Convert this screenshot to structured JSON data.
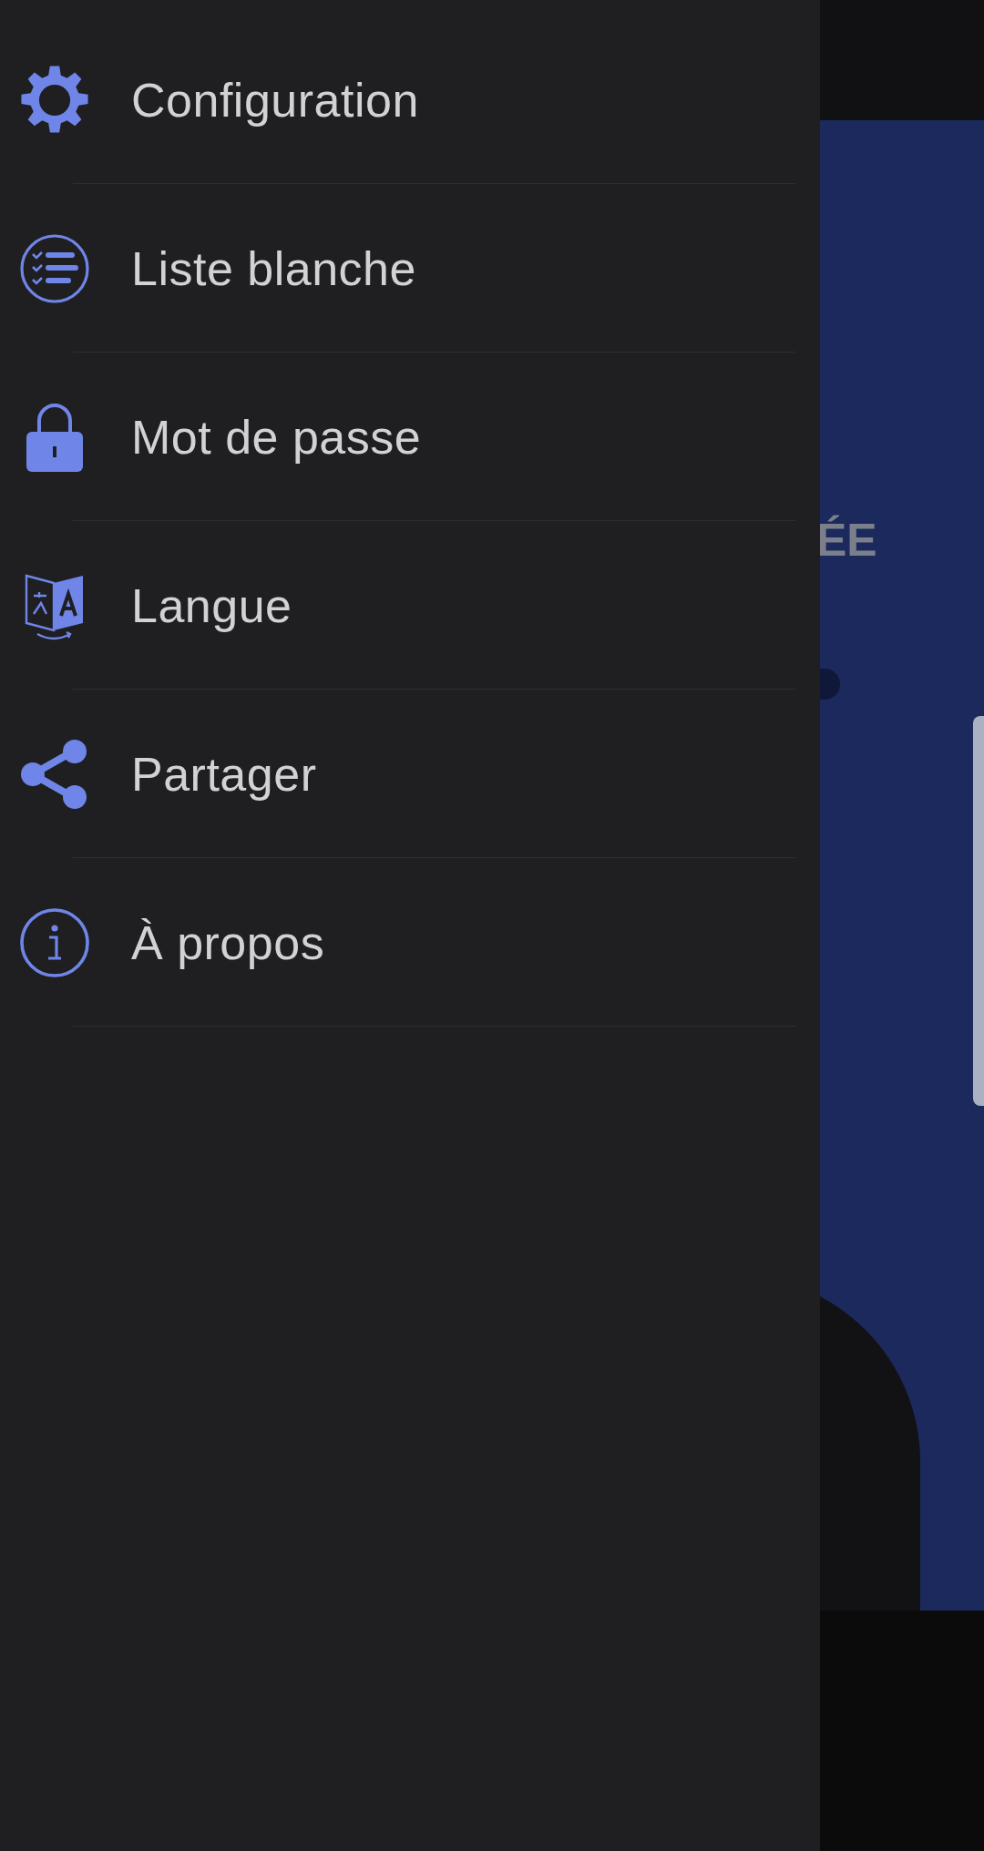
{
  "drawer": {
    "items": [
      {
        "kind": "settings",
        "label": "Configuration"
      },
      {
        "kind": "list",
        "label": "Liste blanche"
      },
      {
        "kind": "lock",
        "label": "Mot de passe"
      },
      {
        "kind": "language",
        "label": "Langue"
      },
      {
        "kind": "share",
        "label": "Partager"
      },
      {
        "kind": "info",
        "label": "À propos"
      }
    ]
  },
  "background": {
    "heading_fragment": "ÉE"
  }
}
